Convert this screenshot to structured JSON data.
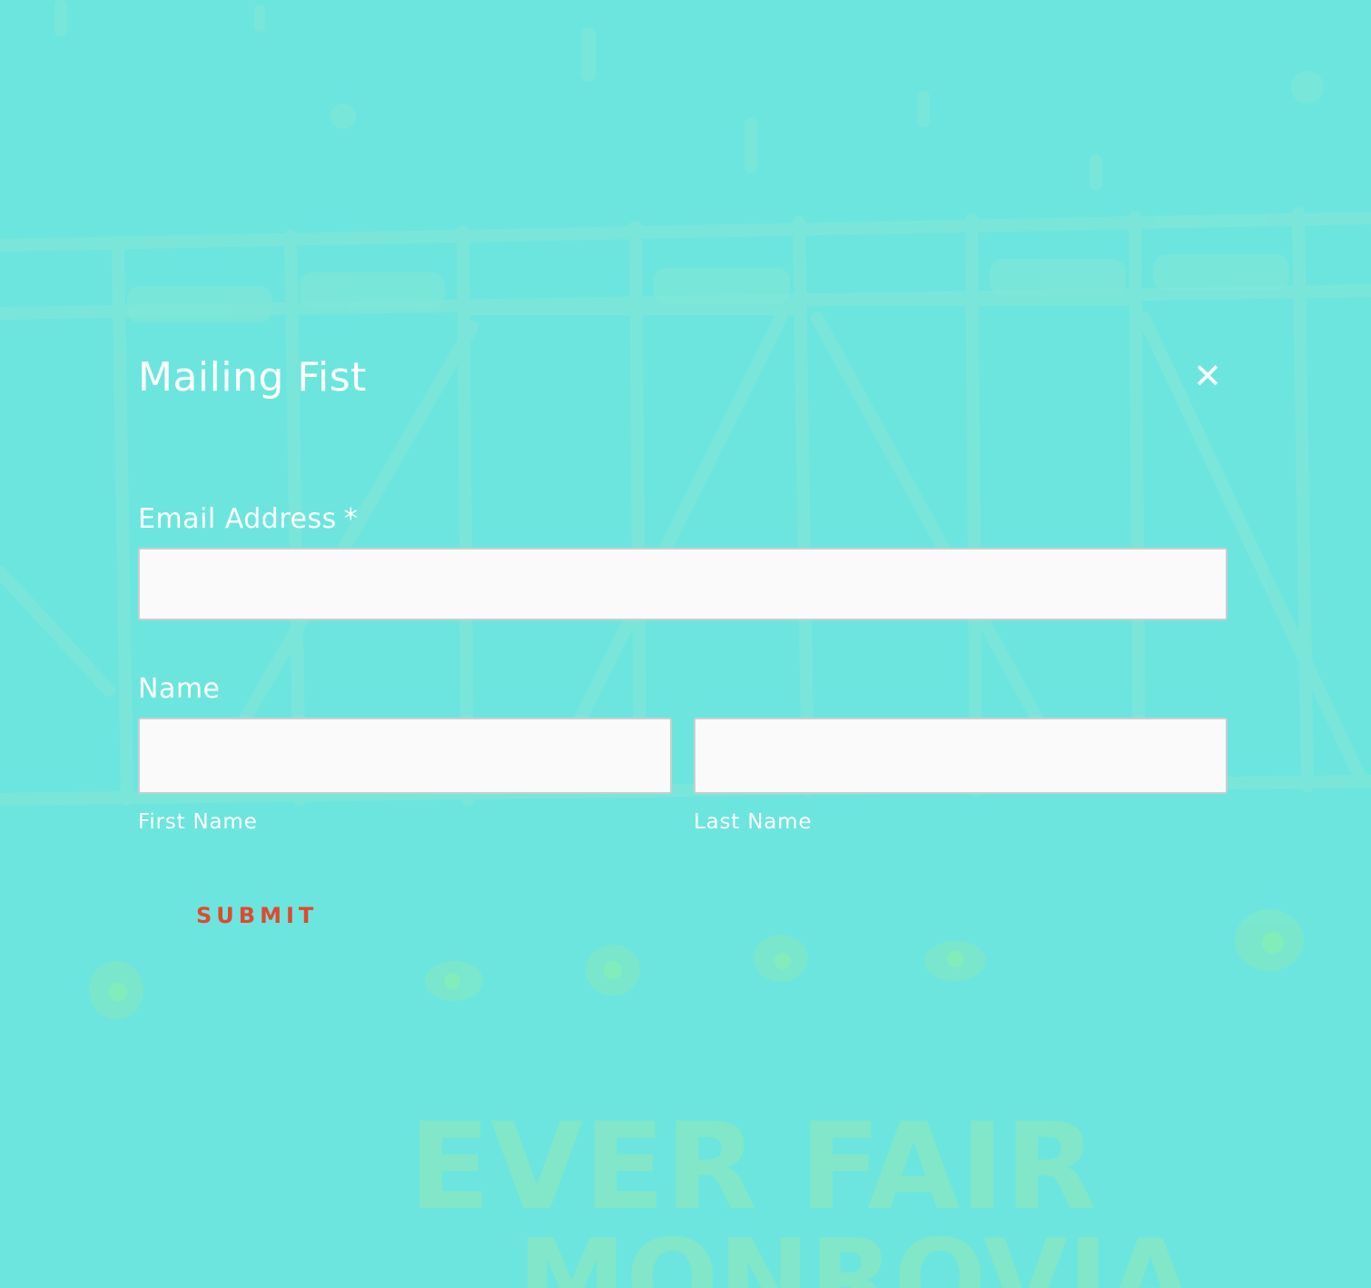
{
  "modal": {
    "title": "Mailing Fist",
    "close_glyph": "✕"
  },
  "form": {
    "email": {
      "label": "Email Address",
      "required_mark": "*",
      "value": "",
      "placeholder": ""
    },
    "name": {
      "label": "Name",
      "first": {
        "sublabel": "First Name",
        "value": "",
        "placeholder": ""
      },
      "last": {
        "sublabel": "Last Name",
        "value": "",
        "placeholder": ""
      }
    },
    "submit_label": "SUBMIT"
  },
  "background": {
    "sign_text_line1": "EVER FAIR",
    "sign_text_line2": "MONROVIA"
  },
  "colors": {
    "background": "#6ce5de",
    "text": "#ffffff",
    "submit": "#e0492f",
    "input_bg": "#fafafa"
  },
  "icons": {
    "close": "close-icon"
  }
}
